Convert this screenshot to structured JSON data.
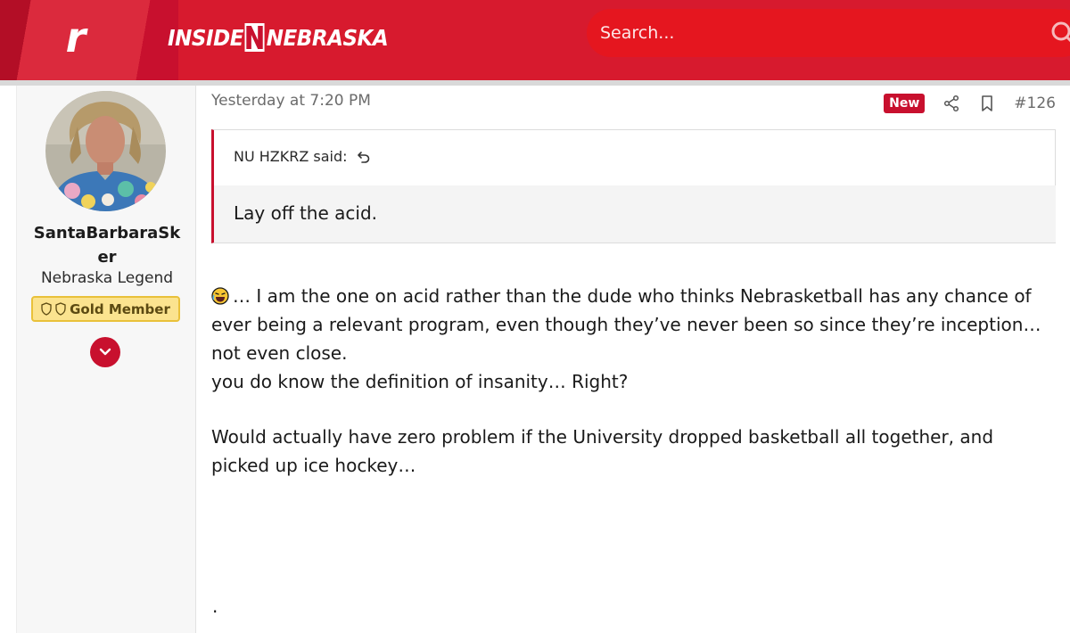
{
  "header": {
    "brand_left": "INSIDE",
    "brand_right": "NEBRASKA",
    "logo_letter": "r",
    "search_placeholder": "Search...",
    "colors": {
      "primary": "#c8102e",
      "search_bg": "#e5161f"
    }
  },
  "user": {
    "name": "SantaBarbaraSker",
    "title": "Nebraska Legend",
    "badge": "Gold Member"
  },
  "post": {
    "date": "Yesterday at 7:20 PM",
    "new_label": "New",
    "number": "#126",
    "quote_author": "NU HZKRZ said:",
    "quote_text": "Lay off the acid.",
    "lines": [
      "… I am the one on acid rather than the dude who thinks Nebrasketball has any chance of",
      "ever being a relevant program, even though they’ve never been so since they’re inception…",
      "not even close.",
      "you do know the definition of insanity… Right?",
      "Would actually have zero problem if the University dropped basketball all together, and",
      "picked up ice hockey…"
    ],
    "trailing": "."
  }
}
